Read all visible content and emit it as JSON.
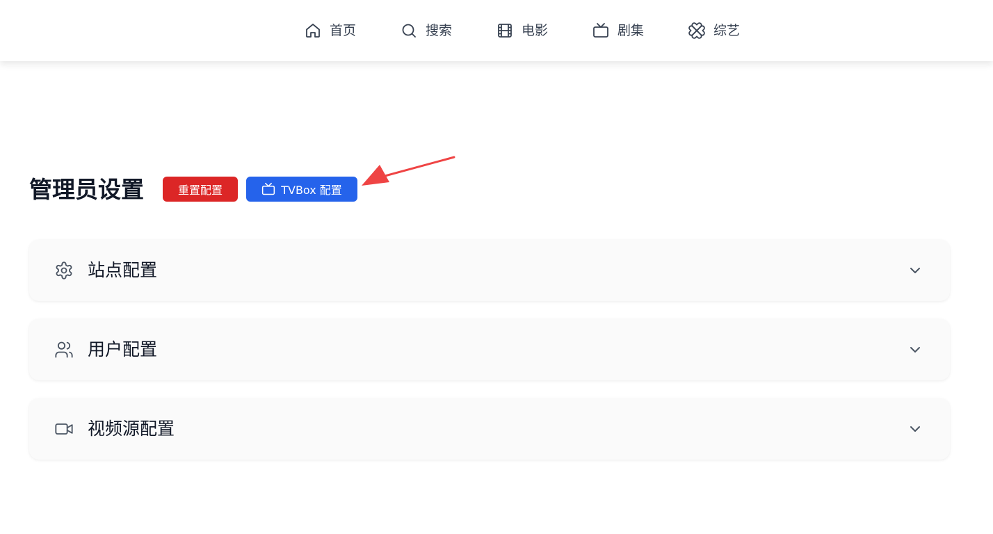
{
  "nav": {
    "items": [
      {
        "label": "首页",
        "icon": "home-icon"
      },
      {
        "label": "搜索",
        "icon": "search-icon"
      },
      {
        "label": "电影",
        "icon": "film-icon"
      },
      {
        "label": "剧集",
        "icon": "tv-icon"
      },
      {
        "label": "综艺",
        "icon": "clover-icon"
      }
    ]
  },
  "header": {
    "title": "管理员设置",
    "reset_label": "重置配置",
    "tvbox_label": "TVBox 配置"
  },
  "panels": [
    {
      "title": "站点配置",
      "icon": "gear-icon"
    },
    {
      "title": "用户配置",
      "icon": "users-icon"
    },
    {
      "title": "视频源配置",
      "icon": "video-icon"
    }
  ],
  "colors": {
    "reset_button": "#dc2626",
    "tvbox_button": "#2563eb",
    "annotation_arrow": "#ef4444",
    "panel_background": "#fafafa"
  }
}
